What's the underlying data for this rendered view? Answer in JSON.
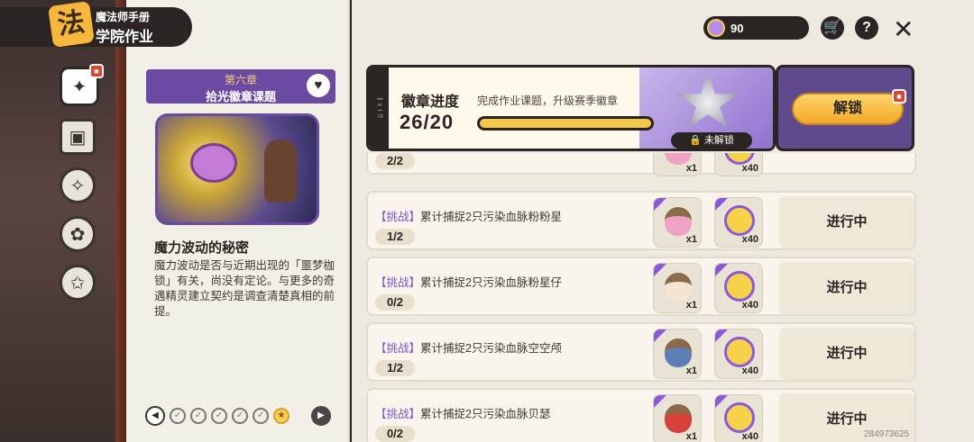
{
  "header": {
    "logo_glyph": "法",
    "subtitle": "魔法师手册",
    "title": "学院作业"
  },
  "side_nav": [
    {
      "icon": "compass-badge-icon",
      "glyph": "✦",
      "active": true,
      "gift": true
    },
    {
      "icon": "cards-icon",
      "glyph": "▣"
    },
    {
      "icon": "creature-icon",
      "glyph": "✧"
    },
    {
      "icon": "paw-icon",
      "glyph": "✿"
    },
    {
      "icon": "star-badge-icon",
      "glyph": "✩"
    }
  ],
  "chapter": {
    "chapter_label": "第六章",
    "chapter_title": "拾光徽章课题",
    "story_title": "魔力波动的秘密",
    "story_text": "魔力波动是否与近期出现的「噩梦枷锁」有关，尚没有定论。与更多的奇遇精灵建立契约是调查清楚真相的前提。"
  },
  "pager": {
    "prev_glyph": "◀",
    "next_glyph": "▶",
    "dots": [
      "✓",
      "✓",
      "✓",
      "✓",
      "✓",
      "★"
    ]
  },
  "hud": {
    "currency_value": "90",
    "shop_glyph": "🛒",
    "help_glyph": "?",
    "close_glyph": "✕"
  },
  "badge": {
    "title": "徽章进度",
    "description": "完成作业课题，升级赛季徽章",
    "count": "26/20",
    "progress_fraction": 1.0,
    "lock_label": "🔒 未解锁",
    "unlock_button": "解锁"
  },
  "tasks": [
    {
      "tag": "",
      "name": "",
      "progress": "2/2",
      "status": "",
      "partial": true,
      "rewards": [
        {
          "count": "x1",
          "kind": "acorn"
        },
        {
          "count": "x40",
          "kind": "gold"
        }
      ]
    },
    {
      "tag": "【挑战】",
      "name": "累计捕捉2只污染血脉粉粉星",
      "progress": "1/2",
      "status": "进行中",
      "rewards": [
        {
          "count": "x1",
          "kind": "acorn"
        },
        {
          "count": "x40",
          "kind": "gold"
        }
      ]
    },
    {
      "tag": "【挑战】",
      "name": "累计捕捉2只污染血脉粉星仔",
      "progress": "0/2",
      "status": "进行中",
      "rewards": [
        {
          "count": "x1",
          "kind": "acorn"
        },
        {
          "count": "x40",
          "kind": "gold"
        }
      ]
    },
    {
      "tag": "【挑战】",
      "name": "累计捕捉2只污染血脉空空颅",
      "progress": "1/2",
      "status": "进行中",
      "rewards": [
        {
          "count": "x1",
          "kind": "acorn"
        },
        {
          "count": "x40",
          "kind": "gold"
        }
      ]
    },
    {
      "tag": "【挑战】",
      "name": "累计捕捉2只污染血脉贝瑟",
      "progress": "0/2",
      "status": "进行中",
      "rewards": [
        {
          "count": "x1",
          "kind": "acorn"
        },
        {
          "count": "x40",
          "kind": "gold"
        }
      ]
    }
  ],
  "watermark": "284973625",
  "colors": {
    "accent_purple": "#6b4aa1",
    "gold": "#f2c94c",
    "dark": "#2a2523"
  }
}
